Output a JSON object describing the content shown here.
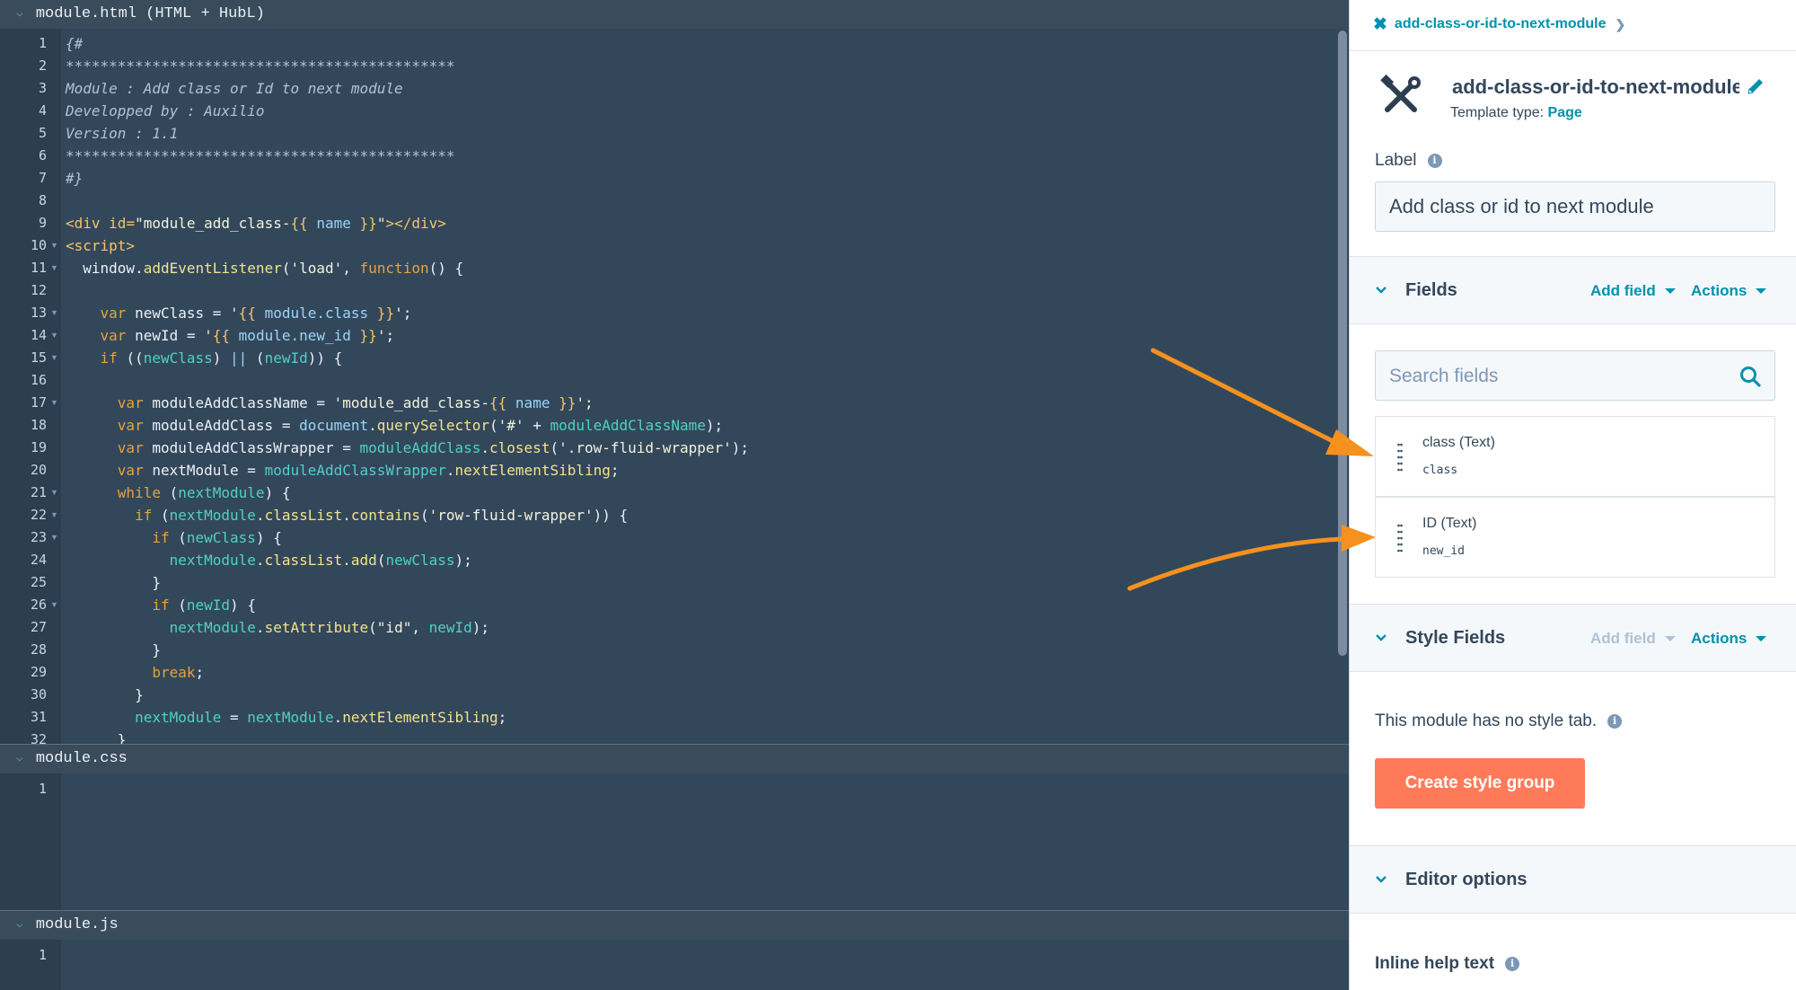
{
  "editor": {
    "html_pane": {
      "title": "module.html (HTML + HubL)",
      "lines": [
        {
          "n": "1",
          "fold": false,
          "segs": [
            [
              "c",
              "{#"
            ]
          ]
        },
        {
          "n": "2",
          "fold": false,
          "segs": [
            [
              "c",
              "*********************************************"
            ]
          ]
        },
        {
          "n": "3",
          "fold": false,
          "segs": [
            [
              "c",
              "Module : Add class or Id to next module"
            ]
          ]
        },
        {
          "n": "4",
          "fold": false,
          "segs": [
            [
              "c",
              "Developped by : Auxilio"
            ]
          ]
        },
        {
          "n": "5",
          "fold": false,
          "segs": [
            [
              "c",
              "Version : 1.1"
            ]
          ]
        },
        {
          "n": "6",
          "fold": false,
          "segs": [
            [
              "c",
              "*********************************************"
            ]
          ]
        },
        {
          "n": "7",
          "fold": false,
          "segs": [
            [
              "c",
              "#}"
            ]
          ]
        },
        {
          "n": "8",
          "fold": false,
          "segs": []
        },
        {
          "n": "9",
          "fold": false,
          "segs": [
            [
              "t",
              "<div "
            ],
            [
              "t",
              "id"
            ],
            [
              "t",
              "="
            ],
            [
              "s",
              "\"module_add_class-"
            ],
            [
              "t",
              "{{ "
            ],
            [
              "h",
              "name"
            ],
            [
              "t",
              " }}"
            ],
            [
              "s",
              "\""
            ],
            [
              "t",
              "></div>"
            ]
          ]
        },
        {
          "n": "10",
          "fold": true,
          "segs": [
            [
              "t",
              "<script>"
            ]
          ]
        },
        {
          "n": "11",
          "fold": true,
          "segs": [
            [
              "p",
              "  window."
            ],
            [
              "m",
              "addEventListener"
            ],
            [
              "p",
              "("
            ],
            [
              "s",
              "'load'"
            ],
            [
              "p",
              ", "
            ],
            [
              "k",
              "function"
            ],
            [
              "p",
              "() {"
            ]
          ]
        },
        {
          "n": "12",
          "fold": false,
          "segs": []
        },
        {
          "n": "13",
          "fold": true,
          "segs": [
            [
              "k",
              "    var "
            ],
            [
              "p",
              "newClass = "
            ],
            [
              "s",
              "'"
            ],
            [
              "t",
              "{{ "
            ],
            [
              "h",
              "module.class"
            ],
            [
              "t",
              " }}"
            ],
            [
              "s",
              "';"
            ]
          ]
        },
        {
          "n": "14",
          "fold": true,
          "segs": [
            [
              "k",
              "    var "
            ],
            [
              "p",
              "newId = "
            ],
            [
              "s",
              "'"
            ],
            [
              "t",
              "{{ "
            ],
            [
              "h",
              "module.new_id"
            ],
            [
              "t",
              " }}"
            ],
            [
              "s",
              "';"
            ]
          ]
        },
        {
          "n": "15",
          "fold": true,
          "segs": [
            [
              "k",
              "    if "
            ],
            [
              "p",
              "(("
            ],
            [
              "v",
              "newClass"
            ],
            [
              "p",
              ") "
            ],
            [
              "h",
              "||"
            ],
            [
              "p",
              " ("
            ],
            [
              "v",
              "newId"
            ],
            [
              "p",
              ")) {"
            ]
          ]
        },
        {
          "n": "16",
          "fold": false,
          "segs": []
        },
        {
          "n": "17",
          "fold": true,
          "segs": [
            [
              "k",
              "      var "
            ],
            [
              "p",
              "moduleAddClassName = "
            ],
            [
              "s",
              "'module_add_class-"
            ],
            [
              "t",
              "{{ "
            ],
            [
              "h",
              "name"
            ],
            [
              "t",
              " }}"
            ],
            [
              "s",
              "';"
            ]
          ]
        },
        {
          "n": "18",
          "fold": false,
          "segs": [
            [
              "k",
              "      var "
            ],
            [
              "p",
              "moduleAddClass = "
            ],
            [
              "h",
              "document"
            ],
            [
              "p",
              "."
            ],
            [
              "m",
              "querySelector"
            ],
            [
              "p",
              "("
            ],
            [
              "s",
              "'#'"
            ],
            [
              "p",
              " + "
            ],
            [
              "v",
              "moduleAddClassName"
            ],
            [
              "p",
              ");"
            ]
          ]
        },
        {
          "n": "19",
          "fold": false,
          "segs": [
            [
              "k",
              "      var "
            ],
            [
              "p",
              "moduleAddClassWrapper = "
            ],
            [
              "v",
              "moduleAddClass"
            ],
            [
              "p",
              "."
            ],
            [
              "m",
              "closest"
            ],
            [
              "p",
              "("
            ],
            [
              "s",
              "'.row-fluid-wrapper'"
            ],
            [
              "p",
              ");"
            ]
          ]
        },
        {
          "n": "20",
          "fold": false,
          "segs": [
            [
              "k",
              "      var "
            ],
            [
              "p",
              "nextModule = "
            ],
            [
              "v",
              "moduleAddClassWrapper"
            ],
            [
              "p",
              "."
            ],
            [
              "m",
              "nextElementSibling"
            ],
            [
              "p",
              ";"
            ]
          ]
        },
        {
          "n": "21",
          "fold": true,
          "segs": [
            [
              "k",
              "      while "
            ],
            [
              "p",
              "("
            ],
            [
              "v",
              "nextModule"
            ],
            [
              "p",
              ") {"
            ]
          ]
        },
        {
          "n": "22",
          "fold": true,
          "segs": [
            [
              "k",
              "        if "
            ],
            [
              "p",
              "("
            ],
            [
              "v",
              "nextModule"
            ],
            [
              "p",
              "."
            ],
            [
              "m",
              "classList"
            ],
            [
              "p",
              "."
            ],
            [
              "m",
              "contains"
            ],
            [
              "p",
              "("
            ],
            [
              "s",
              "'row-fluid-wrapper'"
            ],
            [
              "p",
              ")) {"
            ]
          ]
        },
        {
          "n": "23",
          "fold": true,
          "segs": [
            [
              "k",
              "          if "
            ],
            [
              "p",
              "("
            ],
            [
              "v",
              "newClass"
            ],
            [
              "p",
              ") {"
            ]
          ]
        },
        {
          "n": "24",
          "fold": false,
          "segs": [
            [
              "v",
              "            nextModule"
            ],
            [
              "p",
              "."
            ],
            [
              "m",
              "classList"
            ],
            [
              "p",
              "."
            ],
            [
              "m",
              "add"
            ],
            [
              "p",
              "("
            ],
            [
              "v",
              "newClass"
            ],
            [
              "p",
              ");"
            ]
          ]
        },
        {
          "n": "25",
          "fold": false,
          "segs": [
            [
              "p",
              "          }"
            ]
          ]
        },
        {
          "n": "26",
          "fold": true,
          "segs": [
            [
              "k",
              "          if "
            ],
            [
              "p",
              "("
            ],
            [
              "v",
              "newId"
            ],
            [
              "p",
              ") {"
            ]
          ]
        },
        {
          "n": "27",
          "fold": false,
          "segs": [
            [
              "v",
              "            nextModule"
            ],
            [
              "p",
              "."
            ],
            [
              "m",
              "setAttribute"
            ],
            [
              "p",
              "("
            ],
            [
              "s",
              "\"id\""
            ],
            [
              "p",
              ", "
            ],
            [
              "v",
              "newId"
            ],
            [
              "p",
              ");"
            ]
          ]
        },
        {
          "n": "28",
          "fold": false,
          "segs": [
            [
              "p",
              "          }"
            ]
          ]
        },
        {
          "n": "29",
          "fold": false,
          "segs": [
            [
              "k",
              "          break"
            ],
            [
              "p",
              ";"
            ]
          ]
        },
        {
          "n": "30",
          "fold": false,
          "segs": [
            [
              "p",
              "        }"
            ]
          ]
        },
        {
          "n": "31",
          "fold": false,
          "segs": [
            [
              "v",
              "        nextModule"
            ],
            [
              "p",
              " = "
            ],
            [
              "v",
              "nextModule"
            ],
            [
              "p",
              "."
            ],
            [
              "m",
              "nextElementSibling"
            ],
            [
              "p",
              ";"
            ]
          ]
        },
        {
          "n": "32",
          "fold": false,
          "segs": [
            [
              "p",
              "      }"
            ]
          ]
        }
      ]
    },
    "css_pane": {
      "title": "module.css",
      "lines": [
        {
          "n": "1"
        }
      ]
    },
    "js_pane": {
      "title": "module.js",
      "lines": [
        {
          "n": "1"
        }
      ]
    }
  },
  "sidebar": {
    "breadcrumb": "add-class-or-id-to-next-module",
    "module_name": "add-class-or-id-to-next-module",
    "template_type_label": "Template type:",
    "template_type_value": "Page",
    "label_title": "Label",
    "label_value": "Add class or id  to next module",
    "fields_section": {
      "title": "Fields",
      "add_field": "Add field",
      "actions": "Actions"
    },
    "search_placeholder": "Search fields",
    "fields": [
      {
        "label": "class (Text)",
        "key": "class"
      },
      {
        "label": "ID (Text)",
        "key": "new_id"
      }
    ],
    "style_section": {
      "title": "Style Fields",
      "add_field": "Add field",
      "actions": "Actions"
    },
    "no_style_text": "This module has no style tab.",
    "create_style_button": "Create style group",
    "editor_options_title": "Editor options",
    "inline_help_title": "Inline help text"
  },
  "colors": {
    "editor_bg": "#2d3e50",
    "accent": "#0091ae",
    "create_button": "#ff7a59",
    "annotation_arrow": "#f5911e"
  }
}
